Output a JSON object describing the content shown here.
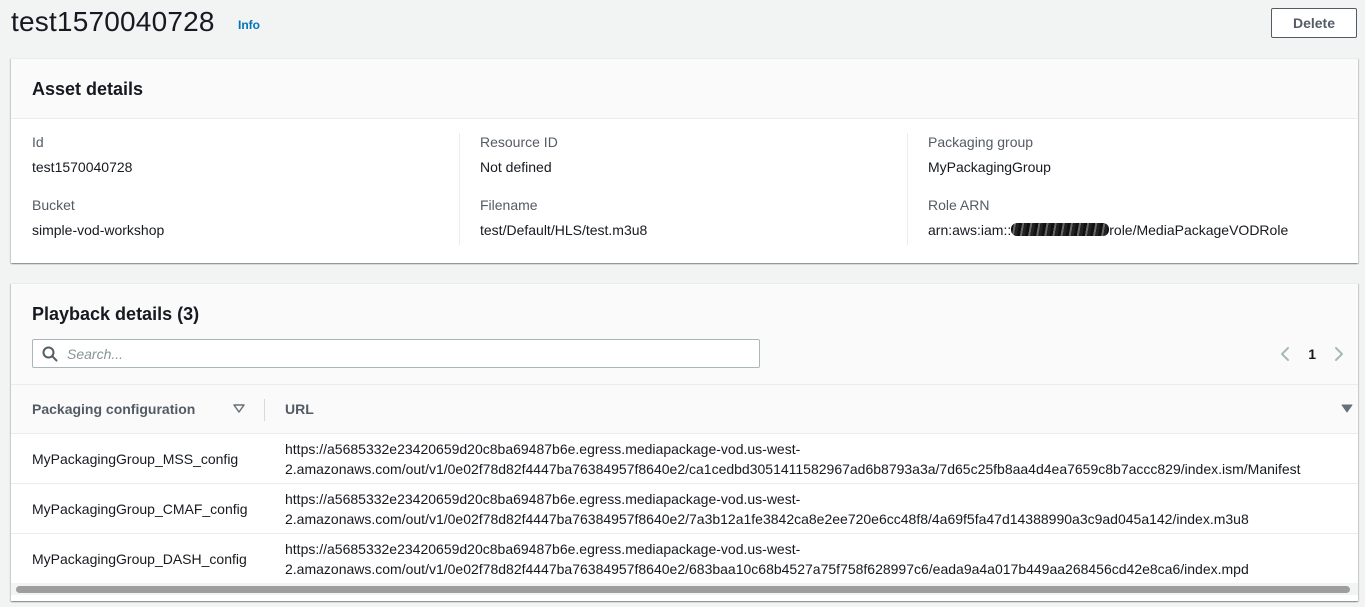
{
  "header": {
    "title": "test1570040728",
    "info_label": "Info",
    "delete_label": "Delete"
  },
  "asset_details": {
    "heading": "Asset details",
    "fields": {
      "id": {
        "label": "Id",
        "value": "test1570040728"
      },
      "resource_id": {
        "label": "Resource ID",
        "value": "Not defined"
      },
      "packaging_group": {
        "label": "Packaging group",
        "value": "MyPackagingGroup"
      },
      "bucket": {
        "label": "Bucket",
        "value": "simple-vod-workshop"
      },
      "filename": {
        "label": "Filename",
        "value": "test/Default/HLS/test.m3u8"
      },
      "role_arn": {
        "label": "Role ARN",
        "value_prefix": "arn:aws:iam::",
        "value_suffix": "role/MediaPackageVODRole"
      }
    }
  },
  "playback_details": {
    "heading": "Playback details",
    "count": "(3)",
    "search_placeholder": "Search...",
    "pager": {
      "current_page": "1"
    },
    "columns": [
      "Packaging configuration",
      "URL"
    ],
    "rows": [
      {
        "config": "MyPackagingGroup_MSS_config",
        "url_line1": "https://a5685332e23420659d20c8ba69487b6e.egress.mediapackage-vod.us-west-",
        "url_line2": "2.amazonaws.com/out/v1/0e02f78d82f4447ba76384957f8640e2/ca1cedbd3051411582967ad6b8793a3a/7d65c25fb8aa4d4ea7659c8b7accc829/index.ism/Manifest"
      },
      {
        "config": "MyPackagingGroup_CMAF_config",
        "url_line1": "https://a5685332e23420659d20c8ba69487b6e.egress.mediapackage-vod.us-west-",
        "url_line2": "2.amazonaws.com/out/v1/0e02f78d82f4447ba76384957f8640e2/7a3b12a1fe3842ca8e2ee720e6cc48f8/4a69f5fa47d14388990a3c9ad045a142/index.m3u8"
      },
      {
        "config": "MyPackagingGroup_DASH_config",
        "url_line1": "https://a5685332e23420659d20c8ba69487b6e.egress.mediapackage-vod.us-west-",
        "url_line2": "2.amazonaws.com/out/v1/0e02f78d82f4447ba76384957f8640e2/683baa10c68b4527a75f758f628997c6/eada9a4a017b449aa268456cd42e8ca6/index.mpd"
      }
    ]
  },
  "colors": {
    "link": "#0073bb",
    "text": "#16191f",
    "label": "#545b64",
    "background": "#f2f3f3"
  }
}
